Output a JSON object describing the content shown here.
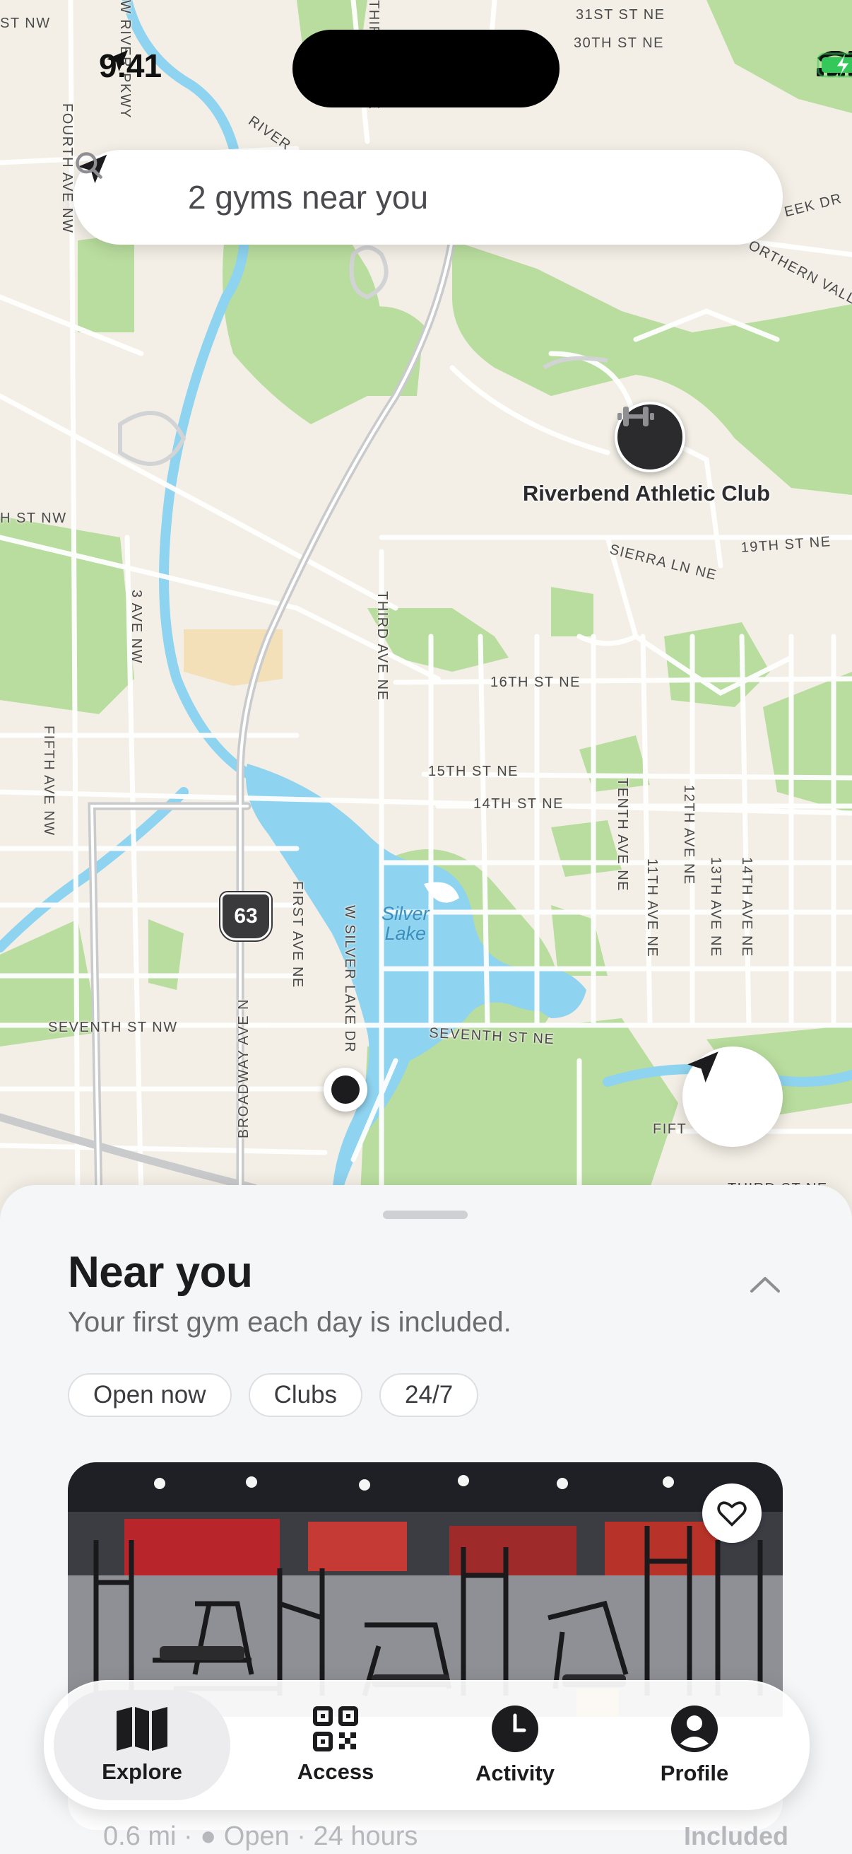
{
  "status_bar": {
    "time": "9:41",
    "icons": [
      "location-arrow-icon",
      "cellular-signal-icon",
      "wifi-icon",
      "battery-charging-icon"
    ],
    "battery_color": "#34c759"
  },
  "search": {
    "text": "2 gyms near you",
    "leading_icon": "location-arrow-icon",
    "trailing_icon": "search-icon"
  },
  "map": {
    "gym_pin": {
      "label": "Riverbend Athletic Club",
      "icon": "dumbbell-icon"
    },
    "route_shield": "63",
    "lake_label": "Silver Lake",
    "street_labels": [
      "31ST ST NE",
      "30TH ST NE",
      "ST NW",
      "W RIVER PKWY",
      "FOURTH AVE NW",
      "RIVER",
      "THIRD AVE NE",
      "EEK DR",
      "ORTHERN VALLEY",
      "H ST NW",
      "SIERRA LN NE",
      "19TH ST NE",
      "3 AVE NW",
      "THIRD AVE NE",
      "16TH ST NE",
      "15TH ST NE",
      "14TH ST NE",
      "FIFTH AVE NW",
      "TENTH AVE NE",
      "11TH AVE NE",
      "12TH AVE NE",
      "13TH AVE NE",
      "14TH AVE NE",
      "FIRST AVE NE",
      "W SILVER LAKE DR",
      "BROADWAY AVE N",
      "SEVENTH ST NW",
      "SEVENTH ST NE",
      "FIFT",
      "THIRD ST NE"
    ]
  },
  "sheet": {
    "title": "Near you",
    "subtitle": "Your first gym each day is included.",
    "filters": [
      "Open now",
      "Clubs",
      "24/7"
    ],
    "card": {
      "distance_status": "0.6 mi · ● Open · 24 hours",
      "badge": "Included"
    }
  },
  "tabs": [
    {
      "label": "Explore",
      "icon": "map-icon",
      "active": true
    },
    {
      "label": "Access",
      "icon": "qr-code-icon",
      "active": false
    },
    {
      "label": "Activity",
      "icon": "clock-icon",
      "active": false
    },
    {
      "label": "Profile",
      "icon": "person-icon",
      "active": false
    }
  ]
}
